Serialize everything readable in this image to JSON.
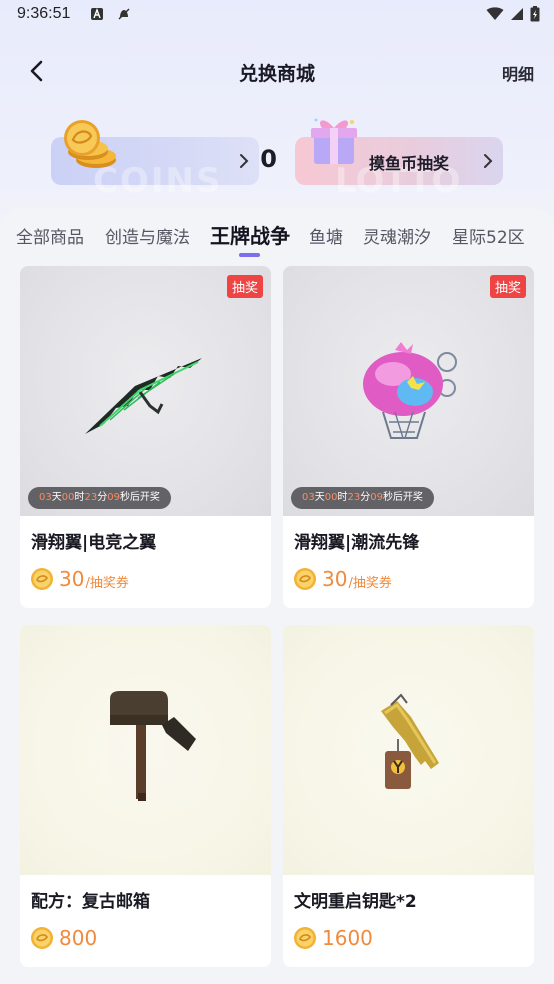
{
  "status_bar": {
    "time": "9:36:51"
  },
  "header": {
    "title": "兑换商城",
    "detail_label": "明细"
  },
  "coins": {
    "count": "0",
    "watermark": "COINS"
  },
  "lottery": {
    "label": "摸鱼币抽奖",
    "watermark": "LOTTO"
  },
  "tabs": [
    {
      "label": "全部商品"
    },
    {
      "label": "创造与魔法"
    },
    {
      "label": "王牌战争"
    },
    {
      "label": "鱼塘"
    },
    {
      "label": "灵魂潮汐"
    },
    {
      "label": "星际52区"
    }
  ],
  "active_tab": "王牌战争",
  "products": [
    {
      "name": "滑翔翼|电竞之翼",
      "badge": "抽奖",
      "countdown": {
        "days": "03",
        "days_unit": "天",
        "hours": "00",
        "hours_unit": "时",
        "minutes": "23",
        "minutes_unit": "分",
        "seconds": "09",
        "suffix": "秒后开奖"
      },
      "price": "30",
      "price_unit": "/抽奖券",
      "image_icon": "glider-wing-icon"
    },
    {
      "name": "滑翔翼|潮流先锋",
      "badge": "抽奖",
      "countdown": {
        "days": "03",
        "days_unit": "天",
        "hours": "00",
        "hours_unit": "时",
        "minutes": "23",
        "minutes_unit": "分",
        "seconds": "09",
        "suffix": "秒后开奖"
      },
      "price": "30",
      "price_unit": "/抽奖券",
      "image_icon": "balloon-glider-icon"
    },
    {
      "name": "配方：复古邮箱",
      "price": "800",
      "image_icon": "mailbox-icon"
    },
    {
      "name": "文明重启钥匙*2",
      "price": "1600",
      "image_icon": "key-icon"
    }
  ],
  "colors": {
    "accent": "#7b6ef0",
    "price": "#f08a3c",
    "badge": "#ef4444"
  }
}
